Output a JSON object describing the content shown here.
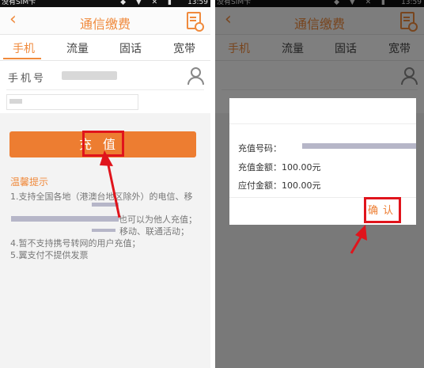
{
  "status_bar": {
    "carrier": "没有SIM卡",
    "time": "13:59",
    "icons": "◆ ▼ ✕ ▮"
  },
  "header": {
    "back_icon": "back-arrow-icon",
    "title": "通信缴费",
    "bill_icon": "bill-icon"
  },
  "tabs": [
    {
      "label": "手机",
      "active": true
    },
    {
      "label": "流量",
      "active": false
    },
    {
      "label": "固话",
      "active": false
    },
    {
      "label": "宽带",
      "active": false
    }
  ],
  "form": {
    "phone_label": "手机号",
    "contact_icon": "contact-icon"
  },
  "recharge_button": {
    "label": "充值"
  },
  "tips": {
    "title": "温馨提示",
    "items": [
      "1.支持全国各地（港澳台地区除外）的电信、移",
      "也可以为他人充值；",
      "移动、联通活动；",
      "4.暂不支持携号转网的用户充值；",
      "5.翼支付不提供发票"
    ]
  },
  "dialog": {
    "number_label": "充值号码：",
    "amount_label": "充值金额：",
    "amount_value": "100.00元",
    "pay_label": "应付金额：",
    "pay_value": "100.00元",
    "confirm_label": "确认"
  },
  "colors": {
    "accent": "#ed7d31",
    "highlight": "#e0141c"
  }
}
